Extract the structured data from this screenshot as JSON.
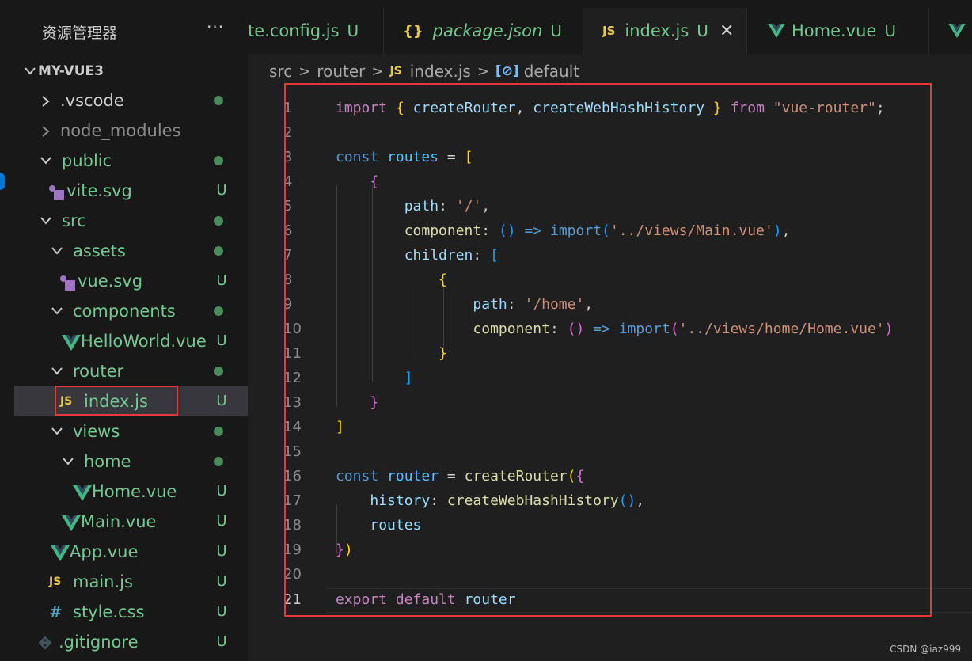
{
  "explorer": {
    "title": "资源管理器",
    "more": "···",
    "root": "MY-VUE3",
    "items": [
      {
        "label": ".vscode",
        "status": "dot"
      },
      {
        "label": "node_modules",
        "status": ""
      },
      {
        "label": "public",
        "status": "dot"
      },
      {
        "label": "vite.svg",
        "status": "U"
      },
      {
        "label": "src",
        "status": "dot"
      },
      {
        "label": "assets",
        "status": "dot"
      },
      {
        "label": "vue.svg",
        "status": "U"
      },
      {
        "label": "components",
        "status": "dot"
      },
      {
        "label": "HelloWorld.vue",
        "status": "U"
      },
      {
        "label": "router",
        "status": "dot"
      },
      {
        "label": "index.js",
        "status": "U"
      },
      {
        "label": "views",
        "status": "dot"
      },
      {
        "label": "home",
        "status": "dot"
      },
      {
        "label": "Home.vue",
        "status": "U"
      },
      {
        "label": "Main.vue",
        "status": "U"
      },
      {
        "label": "App.vue",
        "status": "U"
      },
      {
        "label": "main.js",
        "status": "U"
      },
      {
        "label": "style.css",
        "status": "U"
      },
      {
        "label": ".gitignore",
        "status": "U"
      }
    ]
  },
  "tabs": [
    {
      "label": "te.config.js",
      "status": "U"
    },
    {
      "label": "package.json",
      "status": "U"
    },
    {
      "label": "index.js",
      "status": "U",
      "active": true
    },
    {
      "label": "Home.vue",
      "status": "U"
    }
  ],
  "icons": {
    "js": "JS",
    "json": "{}",
    "css": "#",
    "close": "✕"
  },
  "breadcrumb": [
    "src",
    "router",
    "index.js",
    "default"
  ],
  "editor": {
    "line_numbers": [
      "1",
      "2",
      "3",
      "4",
      "5",
      "6",
      "7",
      "8",
      "9",
      "10",
      "11",
      "12",
      "13",
      "14",
      "15",
      "16",
      "17",
      "18",
      "19",
      "20",
      "21"
    ]
  },
  "watermark": "CSDN @iaz999",
  "colors": {
    "accent": "#0078d4",
    "highlight_box": "#e3383c",
    "git_untracked": "#73c991"
  }
}
